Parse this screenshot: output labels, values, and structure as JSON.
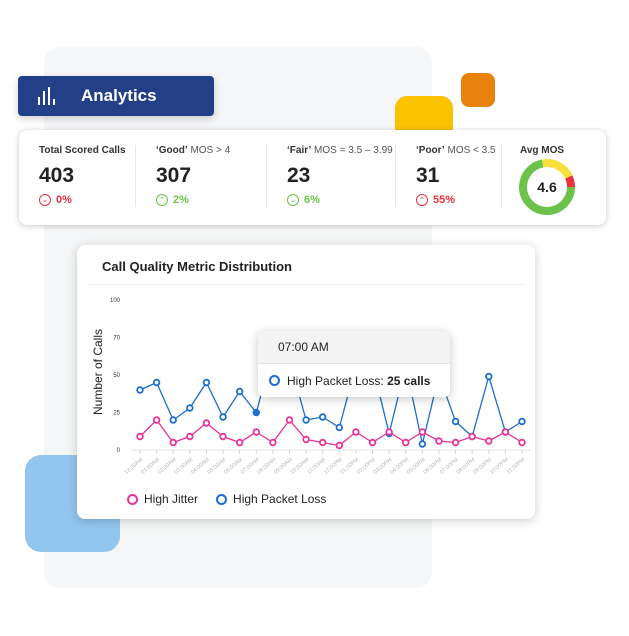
{
  "header": {
    "title": "Analytics",
    "icon": "bar-chart-icon"
  },
  "stats": [
    {
      "title_bold": "Total Scored Calls",
      "title_rest": "",
      "value": "403",
      "delta": "0%",
      "direction": "down",
      "tone": "red"
    },
    {
      "title_bold": "‘Good’",
      "title_rest": " MOS > 4",
      "value": "307",
      "delta": "2%",
      "direction": "up",
      "tone": "green"
    },
    {
      "title_bold": "‘Fair’",
      "title_rest": " MOS = 3.5 – 3.99",
      "value": "23",
      "delta": "6%",
      "direction": "down",
      "tone": "green"
    },
    {
      "title_bold": "‘Poor’",
      "title_rest": " MOS < 3.5",
      "value": "31",
      "delta": "55%",
      "direction": "up",
      "tone": "red"
    }
  ],
  "avg_mos": {
    "title": "Avg MOS",
    "value": "4.6",
    "segments": [
      {
        "name": "good",
        "fraction": 0.72,
        "color": "#6cc24a"
      },
      {
        "name": "fair",
        "fraction": 0.21,
        "color": "#f7e03a"
      },
      {
        "name": "poor",
        "fraction": 0.07,
        "color": "#e8323c"
      }
    ]
  },
  "colors": {
    "brand": "#233f87",
    "jitter": "#e8339a",
    "packet_loss": "#1b6fd1"
  },
  "chart_data": {
    "type": "line",
    "title": "Call Quality Metric Distribution",
    "xlabel": "",
    "ylabel": "Number of Calls",
    "y_ticks": [
      0,
      25,
      50,
      70,
      100
    ],
    "ylim": [
      0,
      100
    ],
    "grid": false,
    "legend_position": "bottom-left",
    "x": [
      "12:00AM",
      "01:00AM",
      "02:00AM",
      "03:00AM",
      "04:00AM",
      "05:00AM",
      "06:00AM",
      "07:00AM",
      "08:00AM",
      "09:00AM",
      "10:00AM",
      "11:00AM",
      "12:00PM",
      "01:00PM",
      "02:00PM",
      "03:00PM",
      "04:00PM",
      "05:00PM",
      "06:00PM",
      "07:00PM",
      "08:00PM",
      "09:00PM",
      "10:00PM",
      "11:00PM"
    ],
    "series": [
      {
        "name": "High Jitter",
        "color": "#e8339a",
        "values": [
          9,
          20,
          5,
          9,
          18,
          9,
          5,
          12,
          5,
          20,
          7,
          5,
          3,
          12,
          5,
          12,
          5,
          12,
          6,
          5,
          9,
          6,
          12,
          5
        ]
      },
      {
        "name": "High Packet Loss",
        "color": "#1b6fd1",
        "values": [
          40,
          45,
          20,
          28,
          45,
          22,
          39,
          25,
          62,
          58,
          20,
          22,
          15,
          55,
          55,
          11,
          55,
          4,
          50,
          19,
          9,
          49,
          12,
          19
        ]
      }
    ],
    "highlight_index": 7
  },
  "tooltip": {
    "time": "07:00 AM",
    "series": "High Packet Loss:",
    "value": "25 calls"
  }
}
